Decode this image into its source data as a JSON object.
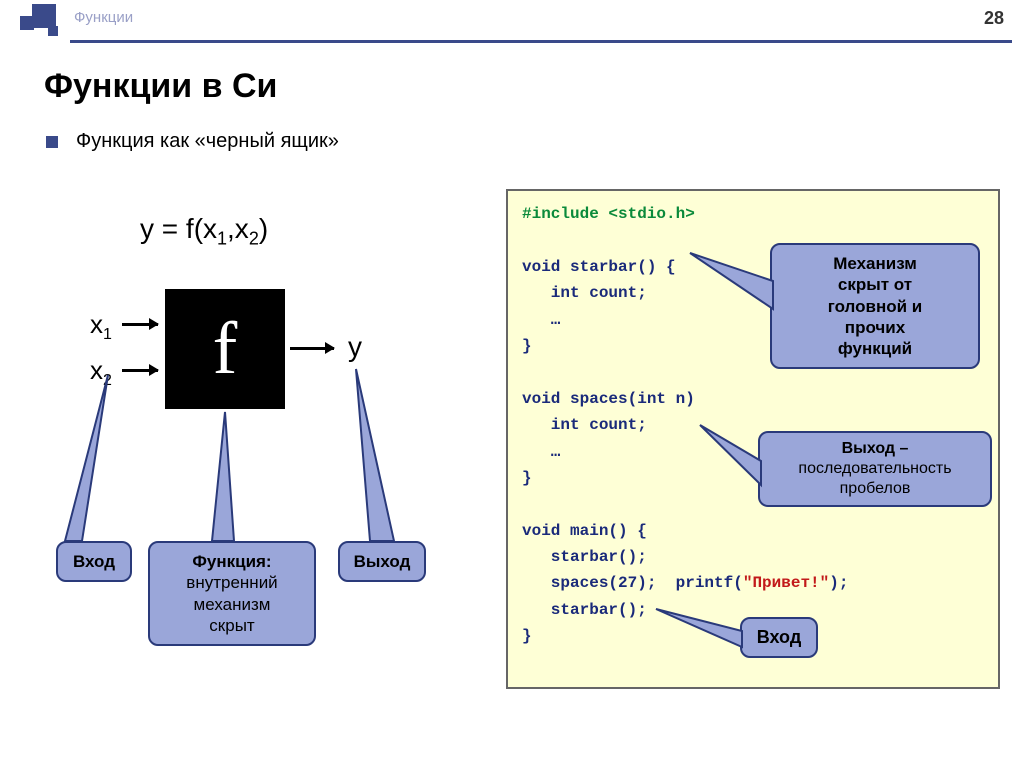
{
  "header": {
    "section_label": "Функции",
    "page_number": "28"
  },
  "title": "Функции в Си",
  "bullet": "Функция как «черный ящик»",
  "diagram": {
    "formula_html": "y = f(x<sub>1</sub>,x<sub>2</sub>)",
    "box_letter": "f",
    "x1_html": "x<sub>1</sub>",
    "x2_html": "x<sub>2</sub>",
    "y": "y",
    "callouts": {
      "input": "Вход",
      "function_bold": "Функция:",
      "function_rest": "внутренний\nмеханизм\nскрыт",
      "output": "Выход"
    }
  },
  "code": {
    "line1_green": "#include <stdio.h>",
    "line2": "void starbar() {",
    "line3": "   int count;",
    "line4": "   …",
    "line5": "}",
    "line6": "void spaces(int n)",
    "line7": "   int count;",
    "line8": "   …",
    "line9": "}",
    "line10": "void main() {",
    "line11": "   starbar();",
    "line12a": "   spaces(27);  printf(",
    "line12b_red": "\"Привет!\"",
    "line12c": ");",
    "line13": "   starbar();",
    "line14": "}"
  },
  "code_callouts": {
    "mechanism": "Механизм\nскрыт от\nголовной и\nпрочих\nфункций",
    "exit_bold": "Выход –",
    "exit_rest": "последовательность\nпробелов",
    "input": "Вход"
  }
}
